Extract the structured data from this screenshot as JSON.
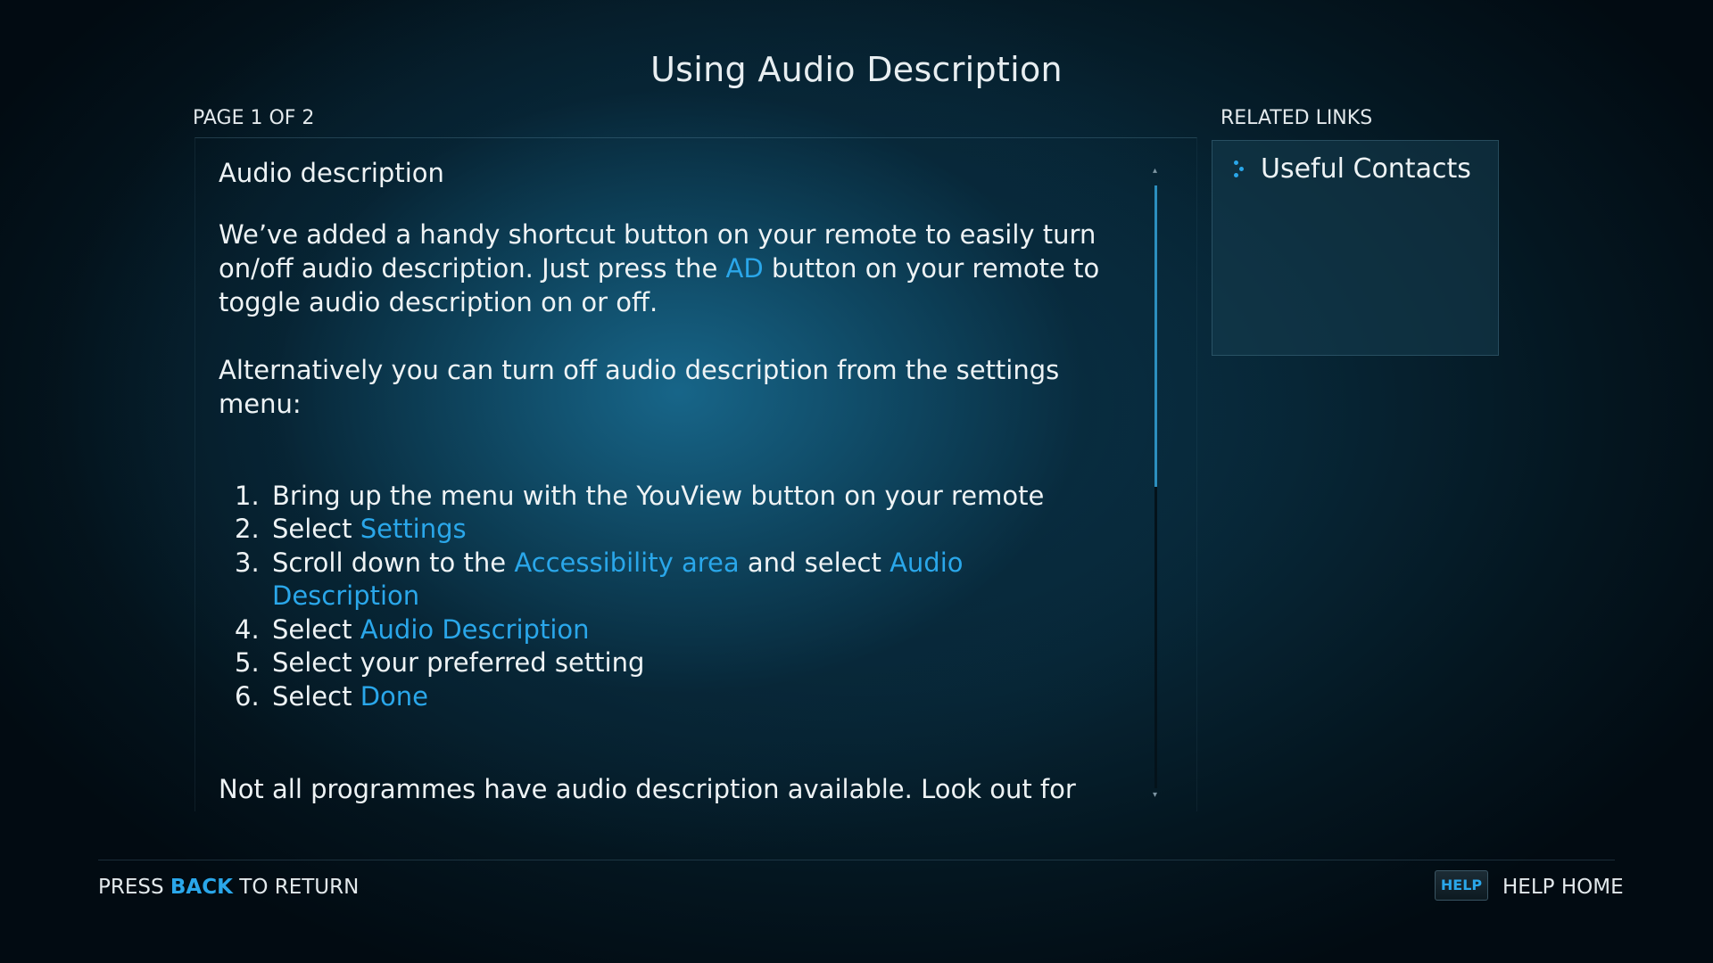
{
  "header": {
    "title": "Using Audio Description",
    "page_indicator": "PAGE 1 OF 2"
  },
  "article": {
    "heading": "Audio description",
    "intro": {
      "before": "We’ve added a handy shortcut button on your remote to easily turn on/off audio description. Just press the ",
      "link": "AD",
      "after": " button on your remote to toggle audio description on or off."
    },
    "alternative": "Alternatively you can turn off audio description from the settings menu:",
    "steps": [
      {
        "num": "1.",
        "parts": [
          {
            "text": "Bring up the menu with the YouView button on your remote",
            "link": false
          }
        ]
      },
      {
        "num": "2.",
        "parts": [
          {
            "text": "Select ",
            "link": false
          },
          {
            "text": "Settings",
            "link": true
          }
        ]
      },
      {
        "num": "3.",
        "parts": [
          {
            "text": "Scroll down to the ",
            "link": false
          },
          {
            "text": "Accessibility area",
            "link": true
          },
          {
            "text": " and select ",
            "link": false
          },
          {
            "text": "Audio Description",
            "link": true
          }
        ]
      },
      {
        "num": "4.",
        "parts": [
          {
            "text": "Select ",
            "link": false
          },
          {
            "text": "Audio Description",
            "link": true
          }
        ]
      },
      {
        "num": "5.",
        "parts": [
          {
            "text": "Select your preferred setting",
            "link": false
          }
        ]
      },
      {
        "num": "6.",
        "parts": [
          {
            "text": "Select ",
            "link": false
          },
          {
            "text": "Done",
            "link": true
          }
        ]
      }
    ],
    "note": "Not all programmes have audio description available. Look out for the [AD] icon on the programme information screen of a TV programme or On Demand programme."
  },
  "scrollbar": {
    "position_fraction": 0.0,
    "visible_fraction": 0.5
  },
  "related": {
    "heading": "RELATED LINKS",
    "items": [
      {
        "label": "Useful Contacts",
        "icon": "dot-bullet-icon"
      }
    ]
  },
  "footer": {
    "press": "PRESS ",
    "back_key": "BACK",
    "to_return": " TO RETURN",
    "help_badge": "HELP",
    "help_home": "HELP HOME"
  },
  "colors": {
    "accent": "#2aa7ea",
    "text": "#eef3f5",
    "background": "#072636"
  }
}
